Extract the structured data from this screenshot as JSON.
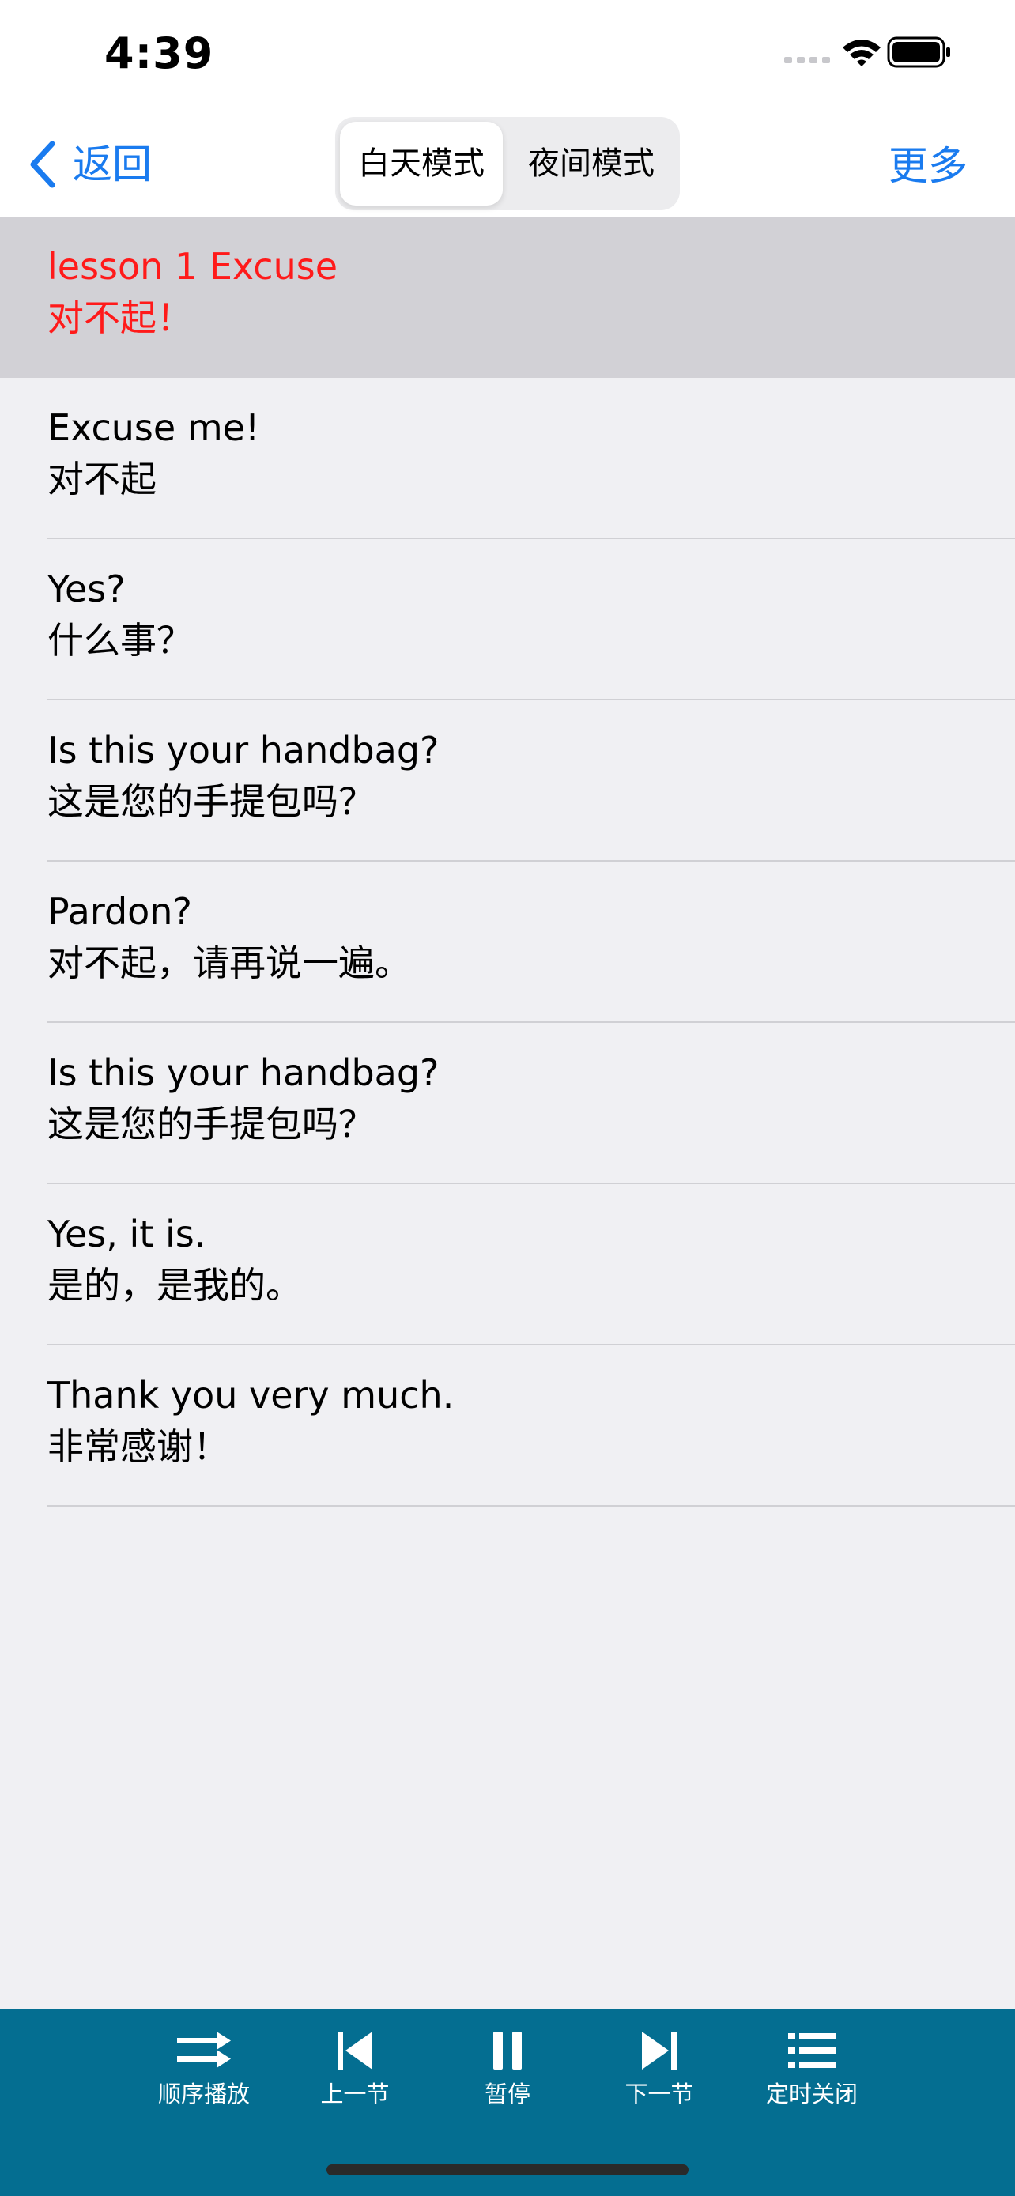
{
  "status_bar": {
    "time": "4:39"
  },
  "nav": {
    "back_label": "返回",
    "segments": [
      "白天模式",
      "夜间模式"
    ],
    "selected_segment": "白天模式",
    "more_label": "更多",
    "accent_color": "#1a7bef"
  },
  "lesson": {
    "title": "lesson 1 Excuse",
    "subtitle": "对不起！",
    "highlight_color": "#ff1a1a"
  },
  "sentences": [
    {
      "en": "Excuse me!",
      "zh": "对不起"
    },
    {
      "en": "Yes?",
      "zh": "什么事？"
    },
    {
      "en": "Is this your handbag?",
      "zh": "这是您的手提包吗？"
    },
    {
      "en": "Pardon?",
      "zh": "对不起，请再说一遍。"
    },
    {
      "en": "Is this your handbag?",
      "zh": "这是您的手提包吗？"
    },
    {
      "en": "Yes, it is.",
      "zh": "是的，是我的。"
    },
    {
      "en": "Thank you very much.",
      "zh": "非常感谢！"
    }
  ],
  "player": {
    "background_color": "#046e91",
    "buttons": [
      {
        "label": "顺序播放",
        "icon": "shuffle-arrows-icon"
      },
      {
        "label": "上一节",
        "icon": "previous-track-icon"
      },
      {
        "label": "暂停",
        "icon": "pause-icon"
      },
      {
        "label": "下一节",
        "icon": "next-track-icon"
      },
      {
        "label": "定时关闭",
        "icon": "list-icon"
      }
    ]
  }
}
